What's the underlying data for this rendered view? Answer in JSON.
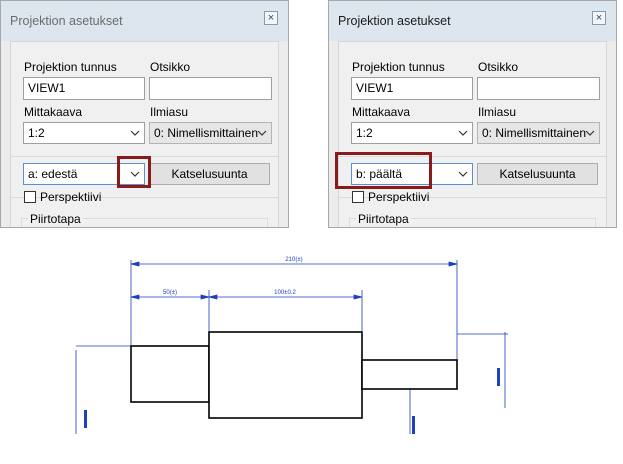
{
  "left_dialog": {
    "title": "Projektion asetukset",
    "close": "×",
    "id_label": "Projektion tunnus",
    "id_value": "VIEW1",
    "header_label": "Otsikko",
    "header_value": "",
    "scale_label": "Mittakaava",
    "scale_value": "1:2",
    "style_label": "Ilmiasu",
    "style_value": "0: Nimellismittainen",
    "direction_value": "a: edestä",
    "view_dir_button": "Katselusuunta",
    "perspective_label": "Perspektiivi",
    "perspective_checked": false,
    "draw_mode_label": "Piirtotapa"
  },
  "right_dialog": {
    "title": "Projektion asetukset",
    "close": "×",
    "id_label": "Projektion tunnus",
    "id_value": "VIEW1",
    "header_label": "Otsikko",
    "header_value": "",
    "scale_label": "Mittakaava",
    "scale_value": "1:2",
    "style_label": "Ilmiasu",
    "style_value": "0: Nimellismittainen",
    "direction_value": "b: päältä",
    "view_dir_button": "Katselusuunta",
    "perspective_label": "Perspektiivi",
    "perspective_checked": false,
    "draw_mode_label": "Piirtotapa"
  },
  "drawing": {
    "dim_total": "210(±)",
    "dim_left": "50(±)",
    "dim_middle": "100±0.2"
  },
  "colors": {
    "highlight": "#8b1a1a",
    "dimension": "#1f3fbf",
    "outline": "#000000"
  }
}
